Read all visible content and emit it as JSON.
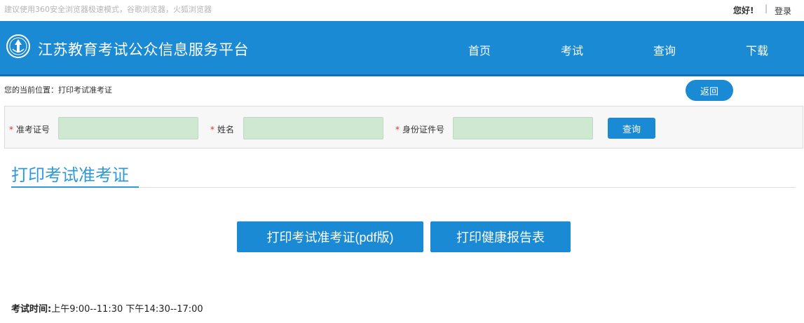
{
  "topbar": {
    "browser_tip": "建议使用360安全浏览器极速模式，谷歌浏览器，火狐浏览器",
    "greeting": "您好!",
    "separator": "|",
    "login": "登录"
  },
  "header": {
    "logo_icon": "exam-emblem-icon",
    "site_title": "江苏教育考试公众信息服务平台",
    "nav": [
      {
        "label": "首页"
      },
      {
        "label": "考试"
      },
      {
        "label": "查询"
      },
      {
        "label": "下载"
      }
    ]
  },
  "breadcrumb": {
    "text": "您的当前位置：打印考试准考证",
    "back_label": "返回"
  },
  "search": {
    "required_mark": "*",
    "fields": [
      {
        "label": "准考证号",
        "value": "",
        "placeholder": ""
      },
      {
        "label": "姓名",
        "value": "",
        "placeholder": ""
      },
      {
        "label": "身份证件号",
        "value": "",
        "placeholder": ""
      }
    ],
    "query_label": "查询"
  },
  "main": {
    "section_title": "打印考试准考证",
    "buttons": [
      {
        "label": "打印考试准考证(pdf版)"
      },
      {
        "label": "打印健康报告表"
      }
    ],
    "exam_time_label": "考试时间:",
    "exam_time_value": "上午9:00--11:30 下午14:30--17:00"
  },
  "colors": {
    "primary": "#1a8ad4",
    "title_blue": "#2f9ad9",
    "input_bg": "#cfe8d2",
    "required": "#e0302d"
  }
}
